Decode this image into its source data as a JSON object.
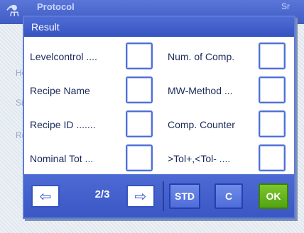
{
  "background": {
    "title": "Protocol",
    "title_right": "Sr",
    "items": [
      "He",
      "Si",
      "Re"
    ]
  },
  "dialog": {
    "title": "Result",
    "left_items": [
      {
        "label": "Levelcontrol ....",
        "checked": false
      },
      {
        "label": "Recipe Name",
        "checked": false
      },
      {
        "label": "Recipe ID .......",
        "checked": false
      },
      {
        "label": "Nominal Tot ...",
        "checked": false
      }
    ],
    "right_items": [
      {
        "label": "Num. of Comp.",
        "checked": false
      },
      {
        "label": "MW-Method ...",
        "checked": false
      },
      {
        "label": "Comp. Counter",
        "checked": false
      },
      {
        "label": ">Tol+,<Tol- ....",
        "checked": false
      }
    ]
  },
  "footer": {
    "page": "2/3",
    "prev_icon": "left-arrow-icon",
    "next_icon": "right-arrow-icon",
    "std_label": "STD",
    "c_label": "C",
    "ok_label": "OK"
  },
  "colors": {
    "header_blue": "#3f5cc4",
    "accent_green": "#6dbb20",
    "checkbox_border": "#4e6fd8"
  }
}
